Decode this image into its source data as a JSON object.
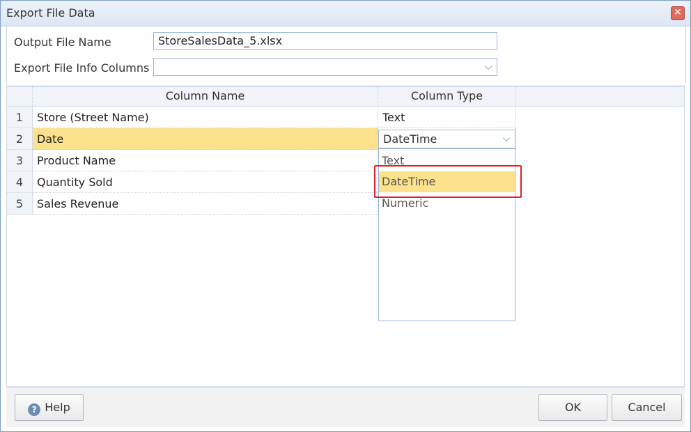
{
  "window": {
    "title": "Export File Data",
    "close_icon": "close-icon",
    "close_glyph": "✕"
  },
  "form": {
    "output_label": "Output File Name",
    "output_value": "StoreSalesData_5.xlsx",
    "info_label": "Export File Info Columns",
    "info_value": "",
    "dropdown_glyph": "⌵"
  },
  "grid": {
    "headers": [
      "Column Name",
      "Column Type"
    ],
    "rows": [
      {
        "num": "1",
        "name": "Store (Street Name)",
        "type": "Text"
      },
      {
        "num": "2",
        "name": "Date",
        "type": "DateTime"
      },
      {
        "num": "3",
        "name": "Product Name",
        "type": ""
      },
      {
        "num": "4",
        "name": "Quantity Sold",
        "type": ""
      },
      {
        "num": "5",
        "name": "Sales Revenue",
        "type": ""
      }
    ],
    "selected_row": 2,
    "type_options": [
      "Text",
      "DateTime",
      "Numeric"
    ],
    "highlighted_option": "DateTime"
  },
  "footer": {
    "help_label": "Help",
    "help_glyph": "?",
    "ok_label": "OK",
    "cancel_label": "Cancel"
  },
  "colors": {
    "selection": "#fde28e",
    "annotation_box": "#e0202a",
    "accent": "#3b7fc4"
  }
}
